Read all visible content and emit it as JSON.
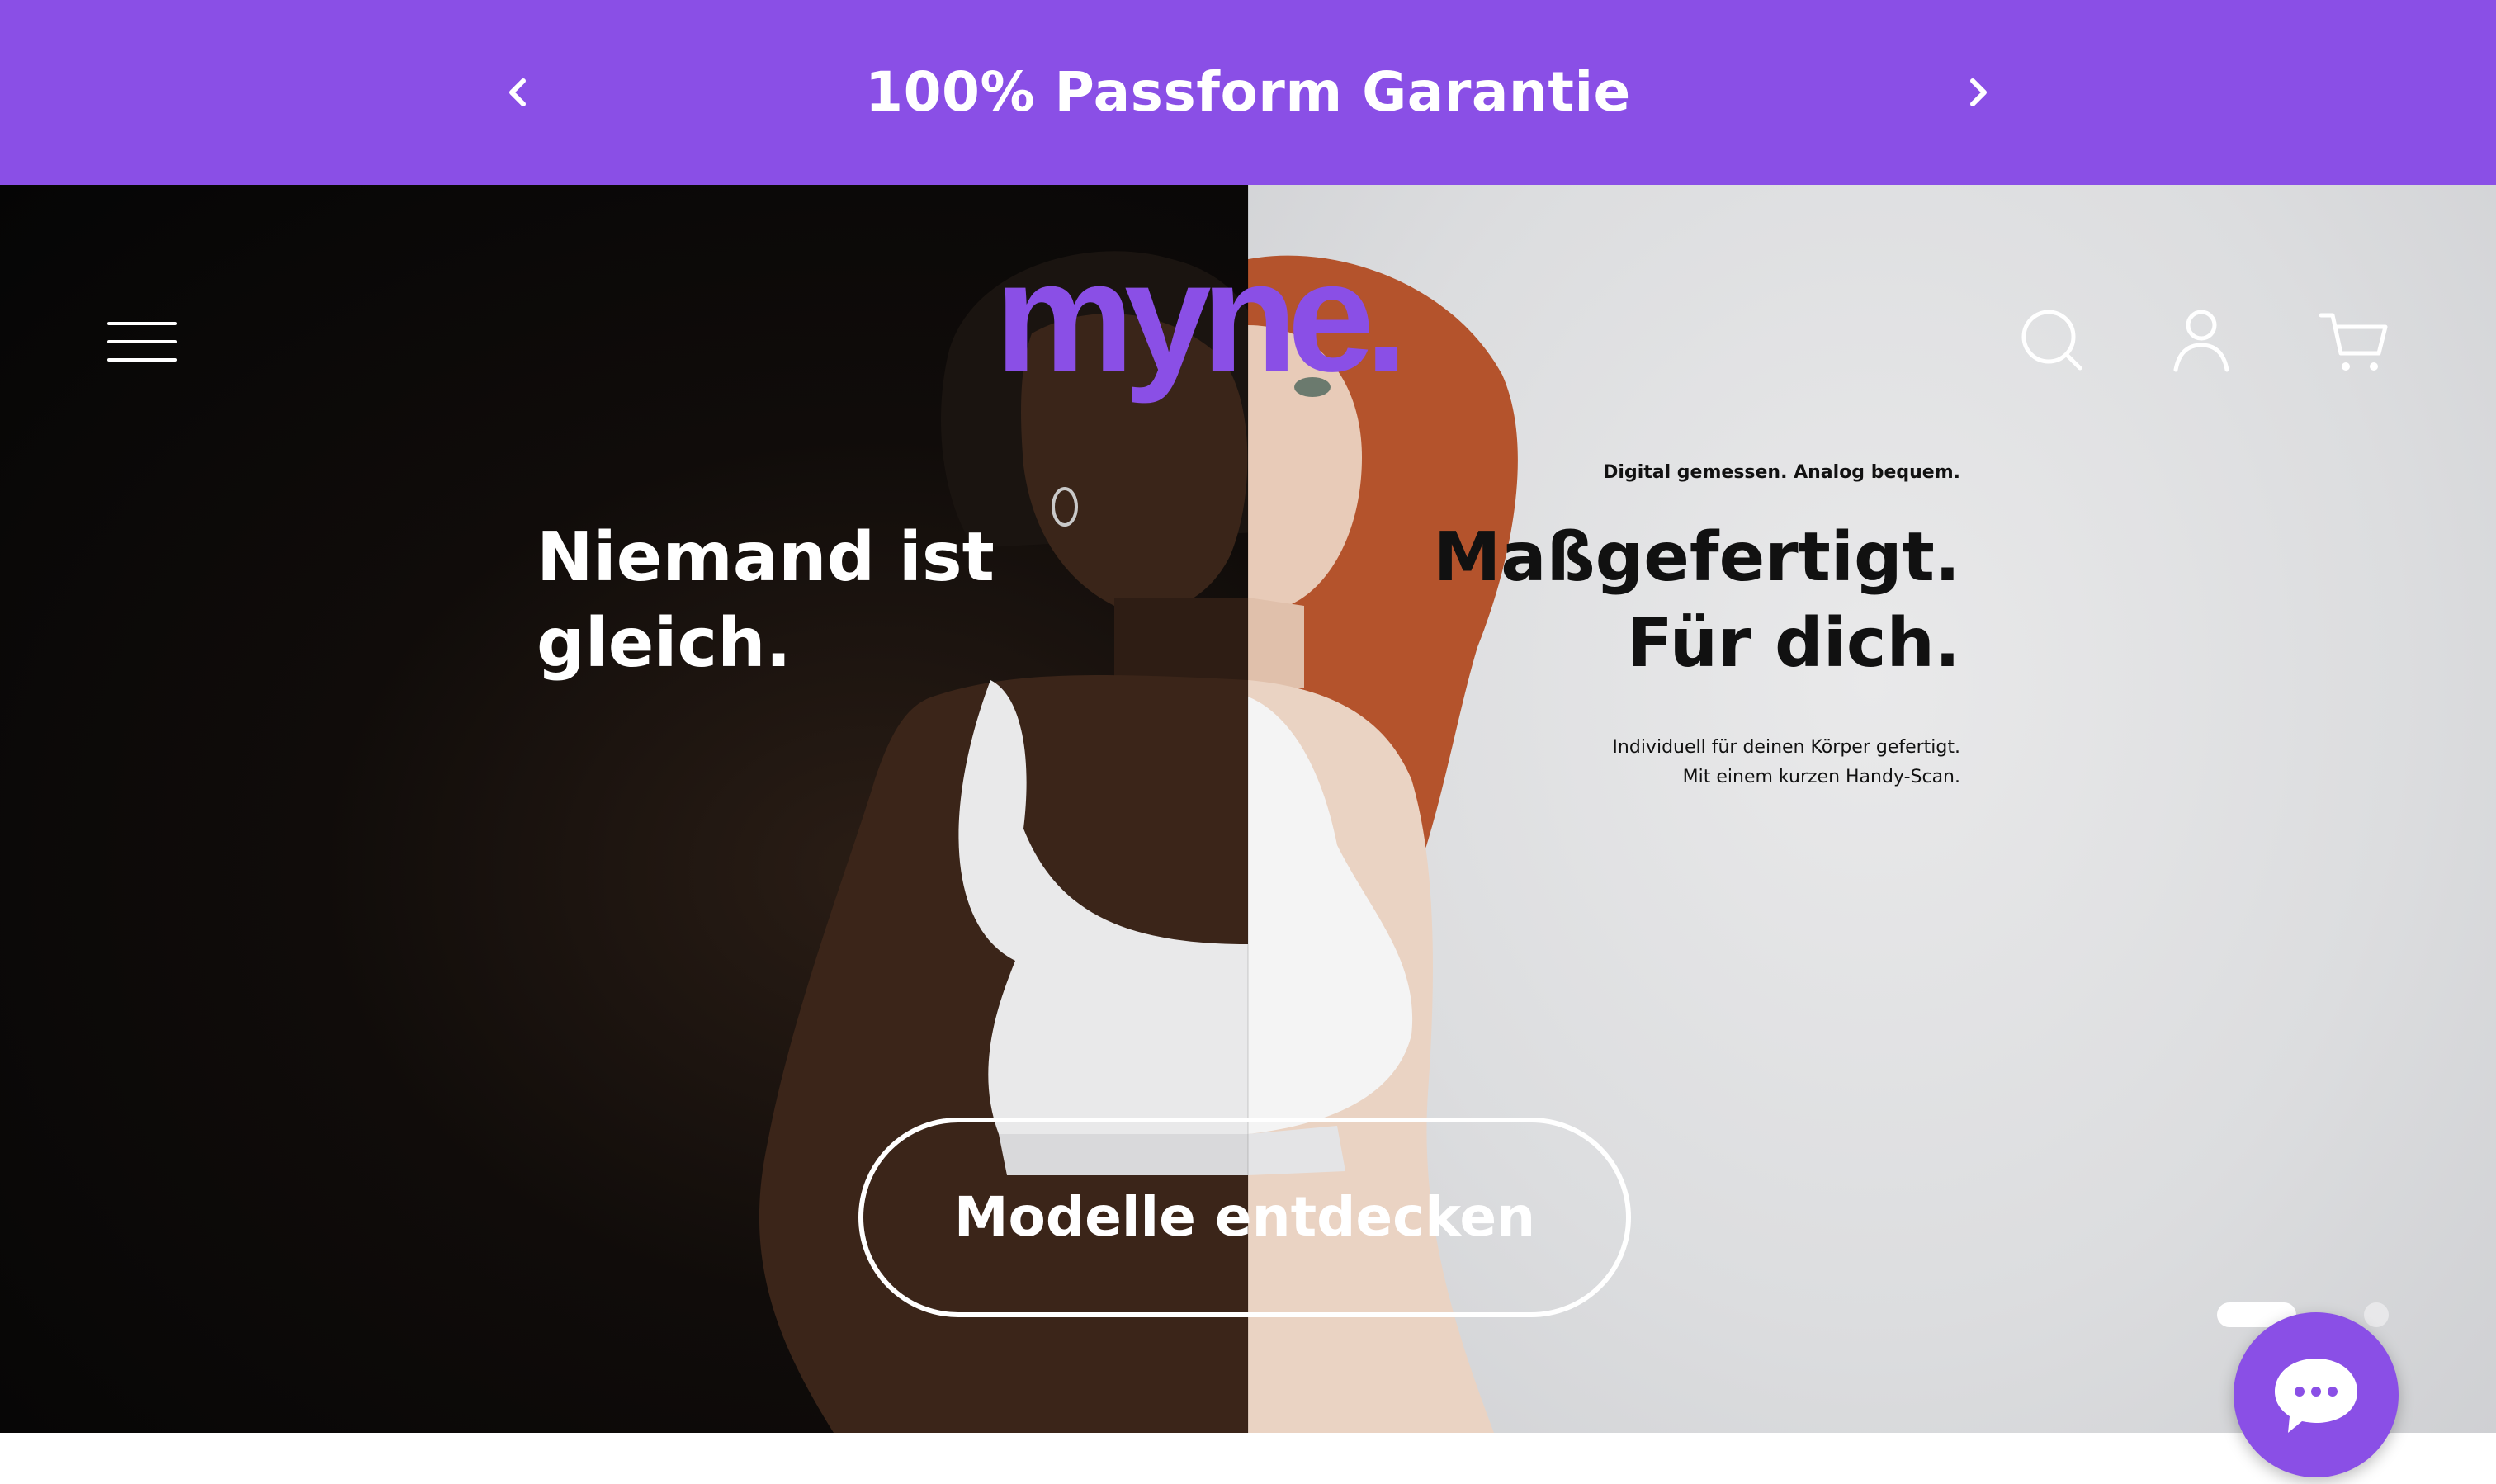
{
  "announcement": {
    "text": "100% Passform Garantie",
    "prev_icon": "chevron-left-icon",
    "next_icon": "chevron-right-icon",
    "background": "#8a4fe6"
  },
  "header": {
    "menu_icon": "hamburger-menu-icon",
    "logo_text": "myne.",
    "search_icon": "search-icon",
    "account_icon": "user-icon",
    "cart_icon": "cart-icon"
  },
  "hero": {
    "left_headline": [
      "Niemand ist",
      "gleich."
    ],
    "right_tagline": "Digital gemessen. Analog bequem.",
    "right_headline": [
      "Maßgefertigt.",
      "Für dich."
    ],
    "right_subtext": [
      "Individuell für deinen Körper gefertigt.",
      "Mit einem kurzen Handy-Scan."
    ],
    "cta_label": "Modelle entdecken",
    "slides": {
      "count": 2,
      "active": 1
    }
  },
  "chat": {
    "icon": "chat-bubble-icon"
  },
  "colors": {
    "brand_purple": "#8a4fe6",
    "text_dark": "#111111",
    "text_light": "#ffffff"
  }
}
